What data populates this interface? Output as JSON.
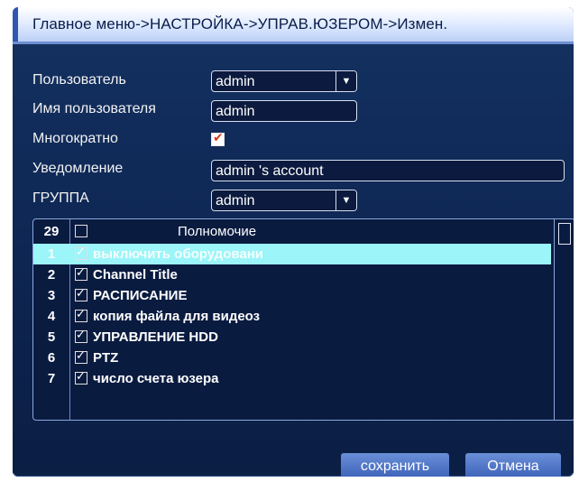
{
  "title": "Главное меню->НАСТРОЙКА->УПРАВ.ЮЗЕРОМ->Измен.",
  "form": {
    "user_label": "Пользователь",
    "user_value": "admin",
    "username_label": "Имя пользователя",
    "username_value": "admin",
    "multi_label": "Многократно",
    "multi_checked": true,
    "notice_label": "Уведомление",
    "notice_value": "admin 's account",
    "group_label": "ГРУППА",
    "group_value": "admin"
  },
  "permissions": {
    "count": "29",
    "header": "Полномочие",
    "rows": [
      {
        "num": "1",
        "label": "выключить оборудовани",
        "checked": true,
        "selected": true
      },
      {
        "num": "2",
        "label": "Channel Title",
        "checked": true,
        "selected": false
      },
      {
        "num": "3",
        "label": "РАСПИСАНИЕ",
        "checked": true,
        "selected": false
      },
      {
        "num": "4",
        "label": "копия файла для видеоз",
        "checked": true,
        "selected": false
      },
      {
        "num": "5",
        "label": "УПРАВЛЕНИЕ HDD",
        "checked": true,
        "selected": false
      },
      {
        "num": "6",
        "label": "PTZ",
        "checked": true,
        "selected": false
      },
      {
        "num": "7",
        "label": "число счета юзера",
        "checked": true,
        "selected": false
      }
    ]
  },
  "buttons": {
    "save": "сохранить",
    "cancel": "Отмена"
  }
}
